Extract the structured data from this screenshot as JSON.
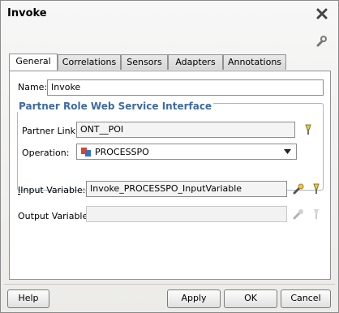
{
  "window": {
    "title": "Invoke"
  },
  "tabs": [
    {
      "label": "General",
      "active": true
    },
    {
      "label": "Correlations",
      "active": false
    },
    {
      "label": "Sensors",
      "active": false
    },
    {
      "label": "Adapters",
      "active": false
    },
    {
      "label": "Annotations",
      "active": false
    }
  ],
  "general": {
    "name_label": "Name:",
    "name_value": "Invoke",
    "group_title": "Partner Role Web Service Interface",
    "partner_link_label": "Partner Link:",
    "partner_link_value": "ONT__POI",
    "operation_label": "Operation:",
    "operation_value": "PROCESSPO",
    "input_variable_label": "Input Variable:",
    "input_variable_value": "Invoke_PROCESSPO_InputVariable",
    "output_variable_label": "Output Variable:",
    "output_variable_value": ""
  },
  "buttons": {
    "help": "Help",
    "apply": "Apply",
    "ok": "OK",
    "cancel": "Cancel"
  },
  "icons": {
    "close": "close-icon",
    "wrench": "wrench-icon",
    "flashlight": "flashlight-icon",
    "create_variable": "create-variable-icon",
    "operation": "operation-icon",
    "dropdown": "chevron-down-icon"
  },
  "colors": {
    "group_title": "#3f6aa1",
    "operation_icon_red": "#d9452f",
    "operation_icon_blue": "#3a6fbf"
  }
}
